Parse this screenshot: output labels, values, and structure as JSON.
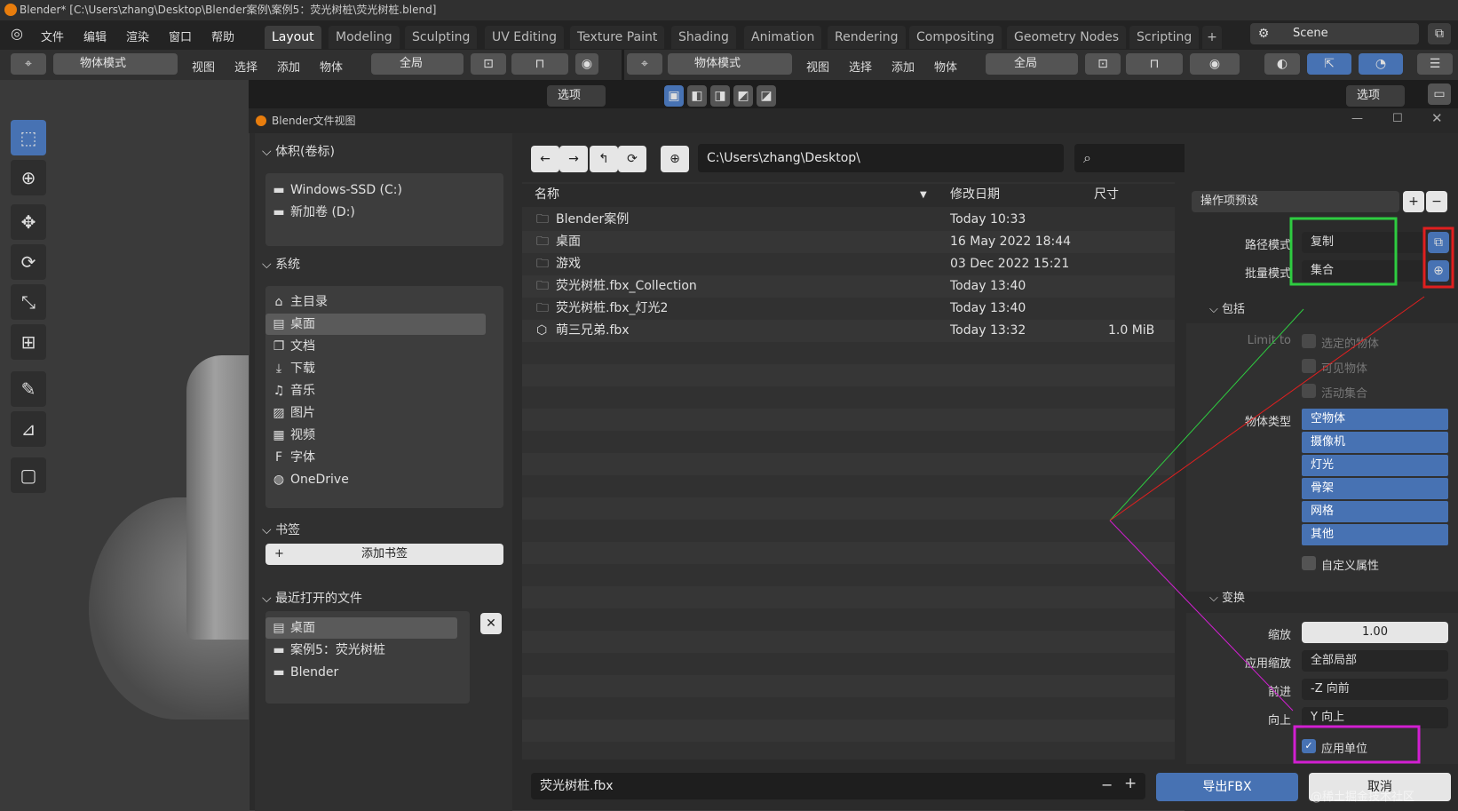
{
  "window": {
    "title": "Blender* [C:\\Users\\zhang\\Desktop\\Blender案例\\案例5：荧光树桩\\荧光树桩.blend]"
  },
  "menu": [
    "文件",
    "编辑",
    "渲染",
    "窗口",
    "帮助"
  ],
  "workspaces": [
    "Layout",
    "Modeling",
    "Sculpting",
    "UV Editing",
    "Texture Paint",
    "Shading",
    "Animation",
    "Rendering",
    "Compositing",
    "Geometry Nodes",
    "Scripting"
  ],
  "active_workspace": "Layout",
  "scene": "Scene",
  "header_left": {
    "mode": "物体模式",
    "menus": [
      "视图",
      "选择",
      "添加",
      "物体"
    ],
    "transform": "全局",
    "options": "选项"
  },
  "header_right": {
    "mode": "物体模式",
    "menus": [
      "视图",
      "选择",
      "添加",
      "物体"
    ],
    "transform": "全局",
    "options": "选项"
  },
  "dialog": {
    "title": "Blender文件视图"
  },
  "volumes": {
    "title": "体积(卷标)",
    "items": [
      "Windows-SSD (C:)",
      "新加卷 (D:)"
    ]
  },
  "system": {
    "title": "系统",
    "items": [
      "主目录",
      "桌面",
      "文档",
      "下载",
      "音乐",
      "图片",
      "视频",
      "字体",
      "OneDrive"
    ],
    "selected": "桌面"
  },
  "bookmarks": {
    "title": "书签",
    "add": "添加书签"
  },
  "recent": {
    "title": "最近打开的文件",
    "items": [
      "桌面",
      "案例5：荧光树桩",
      "Blender"
    ],
    "selected": "桌面"
  },
  "path": "C:\\Users\\zhang\\Desktop\\",
  "columns": {
    "name": "名称",
    "date": "修改日期",
    "size": "尺寸"
  },
  "files": [
    {
      "name": "Blender案例",
      "date": "Today 10:33",
      "size": "",
      "icon": "folder-icon"
    },
    {
      "name": "桌面",
      "date": "16 May 2022 18:44",
      "size": "",
      "icon": "folder-link-icon"
    },
    {
      "name": "游戏",
      "date": "03 Dec 2022 15:21",
      "size": "",
      "icon": "folder-link-icon"
    },
    {
      "name": "荧光树桩.fbx_Collection",
      "date": "Today 13:40",
      "size": "",
      "icon": "folder-icon"
    },
    {
      "name": "荧光树桩.fbx_灯光2",
      "date": "Today 13:40",
      "size": "",
      "icon": "folder-icon"
    },
    {
      "name": "萌三兄弟.fbx",
      "date": "Today 13:32",
      "size": "1.0 MiB",
      "icon": "mesh-icon"
    }
  ],
  "operator": {
    "presets": "操作项预设",
    "path_mode_label": "路径模式",
    "path_mode": "复制",
    "batch_mode_label": "批量模式",
    "batch_mode": "集合",
    "include_title": "包括",
    "limit_to_label": "Limit to",
    "limit_options": [
      "选定的物体",
      "可见物体",
      "活动集合"
    ],
    "object_types_label": "物体类型",
    "object_types": [
      "空物体",
      "摄像机",
      "灯光",
      "骨架",
      "网格",
      "其他"
    ],
    "custom_props": "自定义属性",
    "transform_title": "变换",
    "scale_label": "缩放",
    "scale": "1.00",
    "apply_scaling_label": "应用缩放",
    "apply_scaling": "全部局部",
    "forward_label": "前进",
    "forward": "-Z 向前",
    "up_label": "向上",
    "up": "Y 向上",
    "apply_unit": "应用单位"
  },
  "filename": "荧光树桩.fbx",
  "export_button": "导出FBX",
  "cancel_button": "取消",
  "watermark": "@稀土掘金技术社区",
  "colors": {
    "accent_blue": "#4772b3",
    "green_box": "#2ecc40",
    "red_box": "#e01f1f",
    "magenta_box": "#d21fd2"
  }
}
